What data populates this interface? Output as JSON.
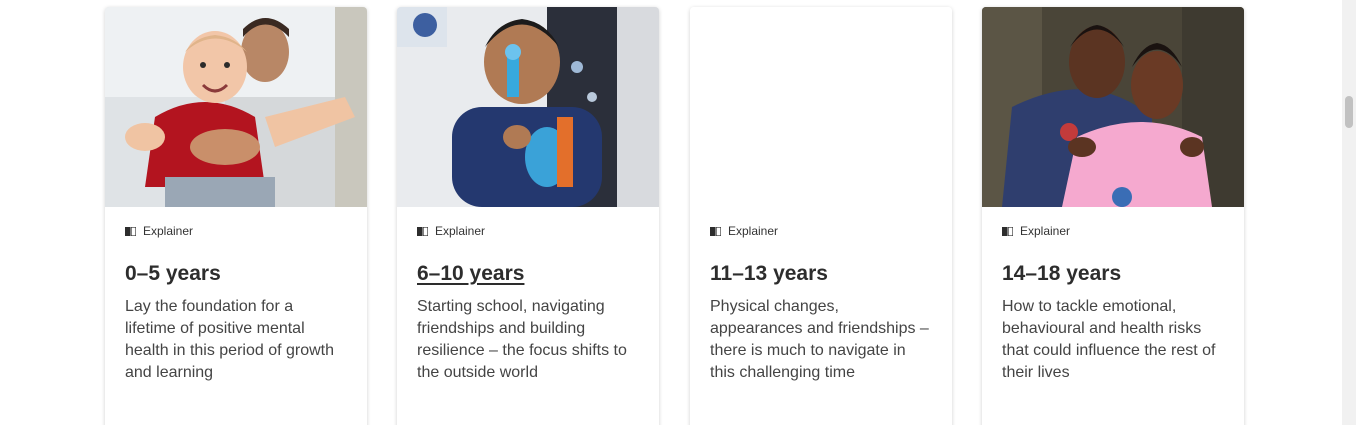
{
  "cards": [
    {
      "tag": "Explainer",
      "title": "0–5 years",
      "description": "Lay the foundation for a lifetime of positive mental health in this period of growth and learning",
      "image": "photo of smiling baby in red top held up by a man"
    },
    {
      "tag": "Explainer",
      "title": "6–10 years",
      "description": "Starting school, navigating friendships and building resilience – the focus shifts to the outside world",
      "image": "photo of boy blowing bubbles"
    },
    {
      "tag": "Explainer",
      "title": "11–13 years",
      "description": "Physical changes, appearances and friendships – there is much to navigate in this challenging time",
      "image": ""
    },
    {
      "tag": "Explainer",
      "title": "14–18 years",
      "description": "How to tackle emotional, behavioural and health risks that could influence the rest of their lives",
      "image": "photo of a woman and a smiling girl in pink shirt"
    }
  ],
  "icons": {
    "tag_icon": "book-icon"
  }
}
